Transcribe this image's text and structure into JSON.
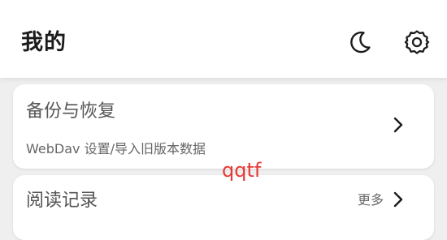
{
  "header": {
    "title": "我的",
    "icons": [
      "moon-icon",
      "gear-icon"
    ]
  },
  "cards": {
    "backup": {
      "title": "备份与恢复",
      "subtitle": "WebDav 设置/导入旧版本数据"
    },
    "history": {
      "title": "阅读记录",
      "more_label": "更多"
    }
  },
  "overlay": {
    "watermark_text": "qqtf"
  },
  "colors": {
    "header_bg": "#ffffff",
    "page_bg": "#efefef",
    "card_bg": "#ffffff",
    "watermark": "#e53935",
    "title_text": "#1b1b1b",
    "card_text": "#555555"
  }
}
